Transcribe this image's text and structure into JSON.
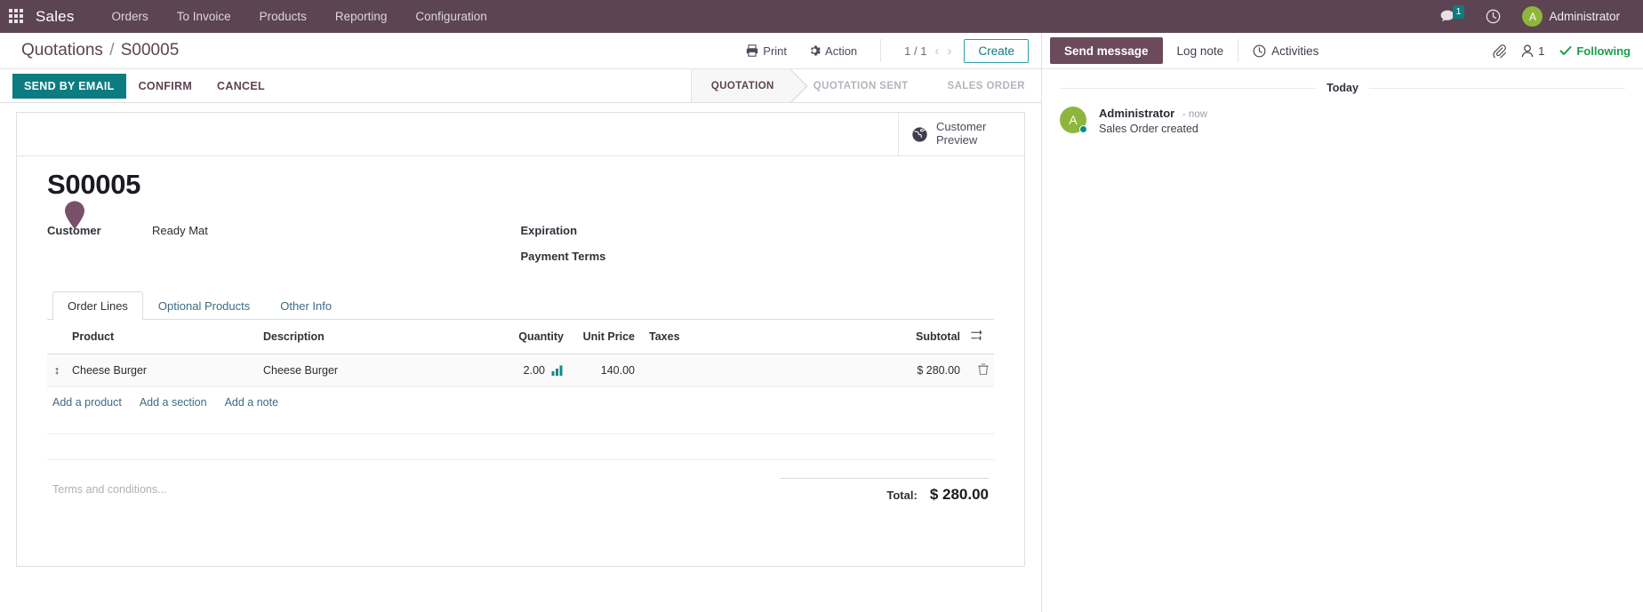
{
  "navbar": {
    "apps_icon": "apps-grid-icon",
    "brand": "Sales",
    "menu": [
      "Orders",
      "To Invoice",
      "Products",
      "Reporting",
      "Configuration"
    ],
    "messages_icon": "chat-bubble-icon",
    "messages_count": "1",
    "activities_icon": "clock-icon",
    "user_initial": "A",
    "user_name": "Administrator"
  },
  "control_panel": {
    "breadcrumb_root": "Quotations",
    "breadcrumb_sep": "/",
    "breadcrumb_current": "S00005",
    "print_label": "Print",
    "print_icon": "printer-icon",
    "action_label": "Action",
    "action_icon": "gear-icon",
    "pager_value": "1 / 1",
    "pager_prev_icon": "chevron-left-icon",
    "pager_next_icon": "chevron-right-icon",
    "create_label": "Create",
    "buttons": [
      {
        "label": "SEND BY EMAIL",
        "style": "primary"
      },
      {
        "label": "CONFIRM",
        "style": "flat"
      },
      {
        "label": "CANCEL",
        "style": "flat"
      }
    ],
    "statusbar": [
      {
        "label": "QUOTATION",
        "active": true
      },
      {
        "label": "QUOTATION SENT",
        "active": false
      },
      {
        "label": "SALES ORDER",
        "active": false
      }
    ]
  },
  "form": {
    "stat_button": {
      "icon": "globe-icon",
      "line1": "Customer",
      "line2": "Preview"
    },
    "record_title": "S00005",
    "fields_left": [
      {
        "label": "Customer",
        "value": "Ready Mat"
      }
    ],
    "fields_right": [
      {
        "label": "Expiration",
        "value": ""
      },
      {
        "label": "Payment Terms",
        "value": ""
      }
    ],
    "tabs": [
      {
        "label": "Order Lines",
        "active": true
      },
      {
        "label": "Optional Products",
        "active": false
      },
      {
        "label": "Other Info",
        "active": false
      }
    ],
    "table": {
      "columns": [
        "Product",
        "Description",
        "Quantity",
        "Unit Price",
        "Taxes",
        "Subtotal"
      ],
      "options_icon": "column-options-icon",
      "rows": [
        {
          "handle_icon": "drag-handle-icon",
          "product": "Cheese Burger",
          "description": "Cheese Burger",
          "quantity": "2.00",
          "quantity_icon": "forecast-report-icon",
          "unit_price": "140.00",
          "taxes": "",
          "subtotal": "$ 280.00",
          "delete_icon": "trash-icon"
        }
      ],
      "add_links": [
        "Add a product",
        "Add a section",
        "Add a note"
      ]
    },
    "terms_placeholder": "Terms and conditions...",
    "total_label": "Total:",
    "total_value": "$ 280.00"
  },
  "chatter": {
    "send_message_label": "Send message",
    "log_note_label": "Log note",
    "activities_label": "Activities",
    "activities_icon": "clock-icon",
    "attachment_icon": "paperclip-icon",
    "followers_icon": "user-icon",
    "followers_count": "1",
    "following_label": "Following",
    "following_icon": "check-icon",
    "day_label": "Today",
    "messages": [
      {
        "avatar_initial": "A",
        "author": "Administrator",
        "time": "- now",
        "body": "Sales Order created"
      }
    ]
  },
  "colors": {
    "navbar_bg": "#5c4452",
    "primary_teal": "#0d7c80",
    "chatter_primary": "#6b4a5c",
    "following_green": "#1b9e4b",
    "avatar_green": "#8fb63c"
  }
}
